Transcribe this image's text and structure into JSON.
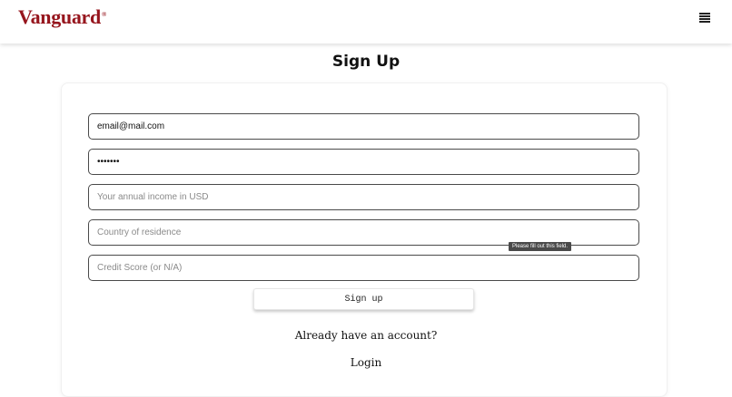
{
  "header": {
    "logo_text": "Vanguard",
    "logo_mark": "®",
    "menu_icon": "hamburger-menu-icon"
  },
  "page": {
    "title": "Sign Up"
  },
  "form": {
    "email": {
      "value": "email@mail.com",
      "placeholder": ""
    },
    "password": {
      "value": "•••••••",
      "placeholder": ""
    },
    "income": {
      "value": "",
      "placeholder": "Your annual income in USD"
    },
    "country": {
      "value": "",
      "placeholder": "Country of residence"
    },
    "credit_score": {
      "value": "",
      "placeholder": "Credit Score (or N/A)"
    },
    "validation_tooltip": "Please fill out this field.",
    "submit_label": "Sign up"
  },
  "footer": {
    "account_prompt": "Already have an account?",
    "login_label": "Login"
  },
  "colors": {
    "brand": "#96151d",
    "field_border": "#4a4a4a",
    "tooltip_bg": "#4a4a4a"
  }
}
